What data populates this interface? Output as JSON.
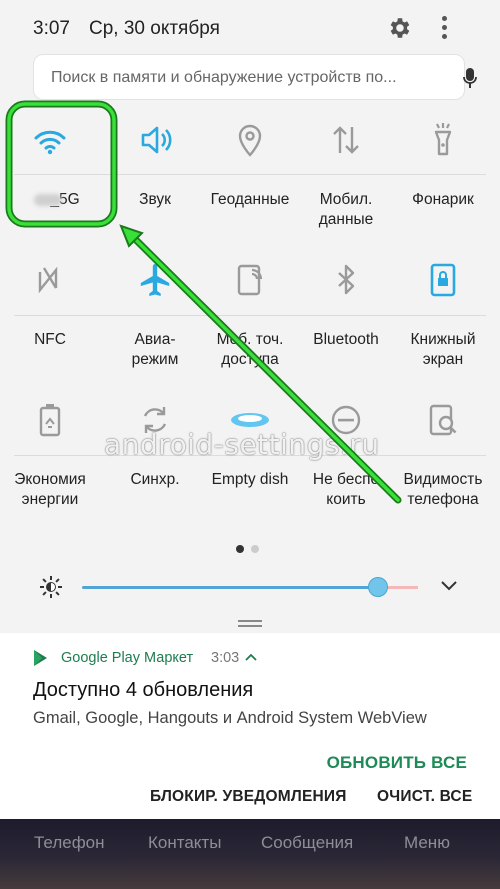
{
  "status_bar": {
    "time": "3:07",
    "date": "Ср, 30 октября"
  },
  "search": {
    "placeholder": "Поиск в памяти и обнаружение устройств по..."
  },
  "colors": {
    "accent": "#2aa8e0",
    "inactive_icon": "#9a9a9a",
    "highlight": "#2ecc2e",
    "app_green": "#1e7d4f"
  },
  "quick_tiles": [
    {
      "label": "_5G",
      "icon": "wifi-icon",
      "active": true
    },
    {
      "label": "Звук",
      "icon": "volume-icon",
      "active": true
    },
    {
      "label": "Геоданные",
      "icon": "location-icon",
      "active": false
    },
    {
      "label": "Мобил.\nданные",
      "icon": "mobile-data-icon",
      "active": false
    },
    {
      "label": "Фонарик",
      "icon": "flashlight-icon",
      "active": false
    },
    {
      "label": "NFC",
      "icon": "nfc-icon",
      "active": false
    },
    {
      "label": "Авиа-\nрежим",
      "icon": "airplane-icon",
      "active": true
    },
    {
      "label": "Моб. точ.\nдоступа",
      "icon": "hotspot-icon",
      "active": false
    },
    {
      "label": "Bluetooth",
      "icon": "bluetooth-icon",
      "active": false
    },
    {
      "label": "Книжный\nэкран",
      "icon": "portrait-lock-icon",
      "active": true
    },
    {
      "label": "Экономия\nэнергии",
      "icon": "battery-saver-icon",
      "active": false
    },
    {
      "label": "Синхр.",
      "icon": "sync-icon",
      "active": false
    },
    {
      "label": "Empty dish",
      "icon": "dish-icon",
      "active": true
    },
    {
      "label": "Не беспо\nкоить",
      "icon": "do-not-disturb-icon",
      "active": false
    },
    {
      "label": "Видимость\nтелефона",
      "icon": "visibility-icon",
      "active": false
    }
  ],
  "pager": {
    "current": 1,
    "total": 2
  },
  "brightness": {
    "level": 0.88
  },
  "watermark": "android-settings.ru",
  "notification": {
    "app": "Google Play Маркет",
    "time": "3:03",
    "title": "Доступно 4 обновления",
    "text": "Gmail, Google, Hangouts и Android System WebView",
    "action": "ОБНОВИТЬ ВСЕ"
  },
  "footer": {
    "block": "БЛОКИР. УВЕДОМЛЕНИЯ",
    "clear": "ОЧИСТ. ВСЕ"
  },
  "dock": [
    "Телефон",
    "Контакты",
    "Сообщения",
    "Меню"
  ]
}
